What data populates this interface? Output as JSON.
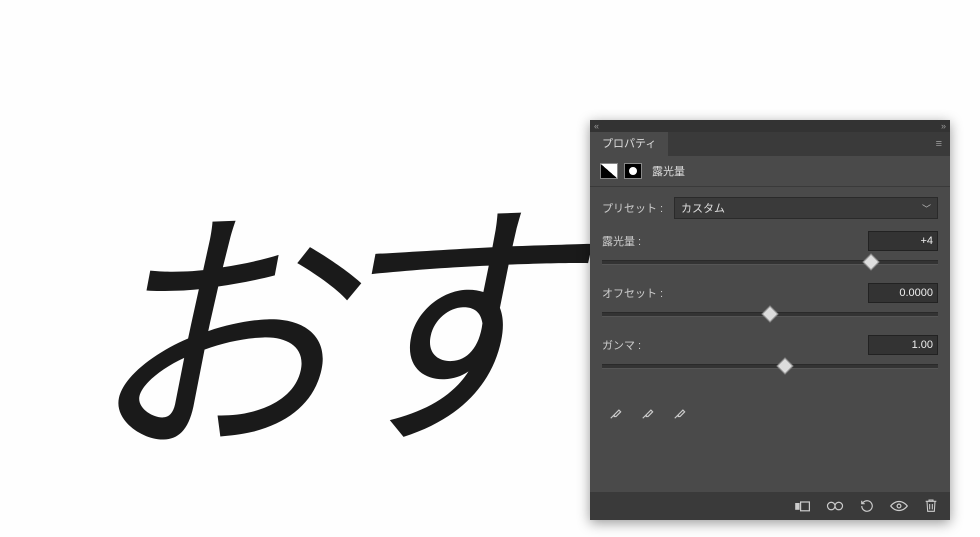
{
  "canvas": {
    "handwriting": "おすす"
  },
  "panel": {
    "tab_label": "プロパティ",
    "adjustment_name": "露光量",
    "preset": {
      "label": "プリセット :",
      "value": "カスタム"
    },
    "exposure": {
      "label": "露光量 :",
      "value": "+4",
      "pos": 0.8
    },
    "offset": {
      "label": "オフセット :",
      "value": "0.0000",
      "pos": 0.5
    },
    "gamma": {
      "label": "ガンマ :",
      "value": "1.00",
      "pos": 0.545
    }
  }
}
